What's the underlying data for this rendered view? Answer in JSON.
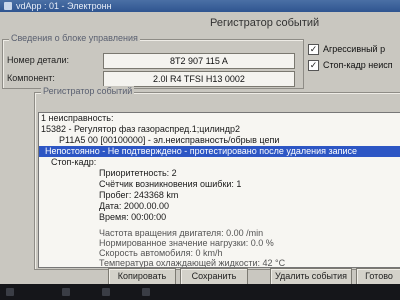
{
  "window": {
    "title": "vdApp : 01 - Электронн",
    "dialog_title": "Регистратор событий"
  },
  "control_unit": {
    "group_label": "Сведения о блоке управления",
    "part_number_label": "Номер детали:",
    "part_number_value": "8T2 907 115 A",
    "component_label": "Компонент:",
    "component_value": "2.0l R4 TFSI    H13 0002"
  },
  "options": {
    "aggressive_label": "Агрессивный р",
    "aggressive_checked": true,
    "freeze_frame_label": "Стоп-кадр неисп",
    "freeze_frame_checked": true
  },
  "event_log": {
    "group_label": "Регистратор событий",
    "lines": [
      "1 неисправность:",
      "15382 - Регулятор фаз газораспред.1;цилиндр2",
      "P11A5 00 [00100000] - эл.неисправность/обрыв цепи",
      "Непостоянно - Не подтверждено - протестировано после удаления записе",
      "Стоп-кадр:",
      "Приоритетность: 2",
      "Счётчик возникновения ошибки: 1",
      "Пробег: 243368 km",
      "Дата: 2000.00.00",
      "Время: 00:00:00",
      "Частота вращения двигателя: 0.00 /min",
      "Нормированное значение нагрузки: 0.0 %",
      "Скорость автомобиля: 0 km/h",
      "Температура охлаждающей жидкости: 42 °C"
    ],
    "selected_index": 3
  },
  "buttons": {
    "copy": "Копировать",
    "save": "Сохранить",
    "delete_events": "Удалить события",
    "done": "Готово"
  }
}
